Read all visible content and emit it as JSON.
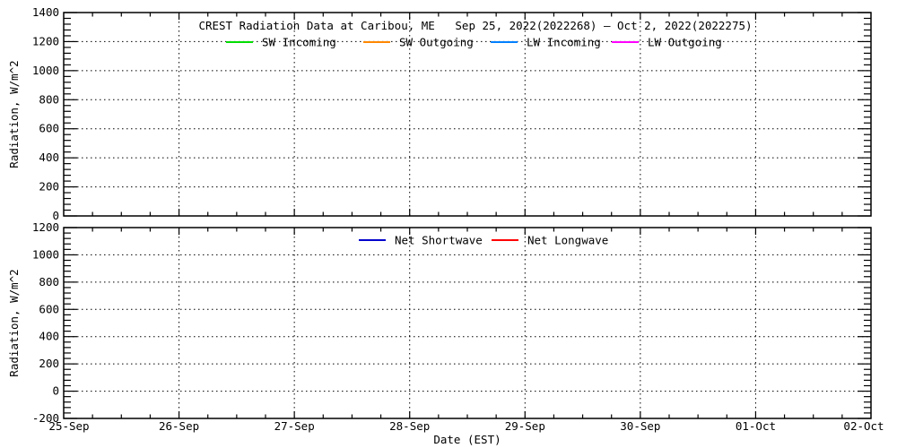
{
  "figure": {
    "background": "#ffffff",
    "foreground": "#000000"
  },
  "chart_data": [
    {
      "type": "line",
      "panel": "top",
      "title": "CREST Radiation Data at Caribou, ME   Sep 25, 2022(2022268) – Oct 2, 2022(2022275)",
      "ylabel": "Radiation, W/m^2",
      "ylim": [
        0,
        1400
      ],
      "yticks": [
        0,
        200,
        400,
        600,
        800,
        1000,
        1200,
        1400
      ],
      "y_minor_per_major": 4,
      "x_ticks": [
        "25-Sep",
        "26-Sep",
        "27-Sep",
        "28-Sep",
        "29-Sep",
        "30-Sep",
        "01-Oct",
        "02-Oct"
      ],
      "x_minor_per_major": 3,
      "x_tick_labels_shown": false,
      "grid": "dotted",
      "legend_position": "top-inside",
      "legend": [
        {
          "name": "SW Incoming",
          "color": "#00dd00"
        },
        {
          "name": "SW Outgoing",
          "color": "#ff8800"
        },
        {
          "name": "LW Incoming",
          "color": "#0080ff"
        },
        {
          "name": "LW Outgoing",
          "color": "#ff00ff"
        }
      ],
      "series": [],
      "no_data_plotted": true
    },
    {
      "type": "line",
      "panel": "bottom",
      "title": "",
      "xlabel": "Date (EST)",
      "ylabel": "Radiation, W/m^2",
      "ylim": [
        -200,
        1200
      ],
      "yticks": [
        -200,
        0,
        200,
        400,
        600,
        800,
        1000,
        1200
      ],
      "y_minor_per_major": 4,
      "x_ticks": [
        "25-Sep",
        "26-Sep",
        "27-Sep",
        "28-Sep",
        "29-Sep",
        "30-Sep",
        "01-Oct",
        "02-Oct"
      ],
      "x_minor_per_major": 3,
      "x_tick_labels_shown": true,
      "grid": "dotted",
      "legend_position": "top-inside",
      "legend": [
        {
          "name": "Net Shortwave",
          "color": "#0000cc"
        },
        {
          "name": "Net Longwave",
          "color": "#ff0000"
        }
      ],
      "series": [],
      "no_data_plotted": true
    }
  ]
}
